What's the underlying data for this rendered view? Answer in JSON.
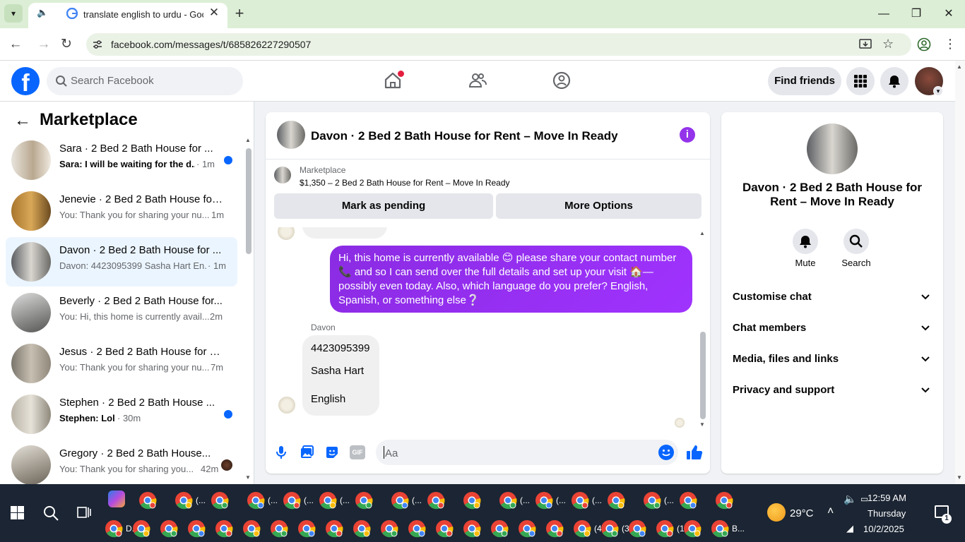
{
  "browser": {
    "tab_title": "translate english to urdu - Goog",
    "url": "facebook.com/messages/t/685826227290507"
  },
  "facebook": {
    "search_placeholder": "Search Facebook",
    "find_friends": "Find friends"
  },
  "marketplace": {
    "title": "Marketplace",
    "conversations": [
      {
        "name": "Sara · 2 Bed 2 Bath House for ...",
        "preview": "Sara: I will be waiting for the d...",
        "time": "· 1m",
        "unread": true,
        "bold_preview": true
      },
      {
        "name": "Jenevie · 2 Bed 2 Bath House for...",
        "preview": "You: Thank you for sharing your nu...",
        "time": "1m",
        "unread": false,
        "bold_preview": false
      },
      {
        "name": "Davon · 2 Bed 2 Bath House for ...",
        "preview": "Davon: 4423095399 Sasha Hart En...",
        "time": "· 1m",
        "unread": false,
        "bold_preview": false
      },
      {
        "name": "Beverly · 2 Bed 2 Bath House for...",
        "preview": "You: Hi, this home is currently avail...",
        "time": "2m",
        "unread": false,
        "bold_preview": false
      },
      {
        "name": "Jesus · 2 Bed 2 Bath House for R...",
        "preview": "You: Thank you for sharing your nu...",
        "time": "7m",
        "unread": false,
        "bold_preview": false
      },
      {
        "name": "Stephen · 2 Bed 2 Bath House ...",
        "preview": "Stephen: Lol",
        "time": "· 30m",
        "unread": true,
        "bold_preview": true
      },
      {
        "name": "Gregory · 2 Bed 2 Bath House...",
        "preview": "You: Thank you for sharing you...",
        "time": "42m",
        "unread": false,
        "bold_preview": false
      }
    ]
  },
  "chat": {
    "title": "Davon · 2 Bed 2 Bath House for Rent – Move In Ready",
    "listing_label": "Marketplace",
    "listing_price": "$1,350 – 2 Bed 2 Bath House for Rent – Move In Ready",
    "mark_pending": "Mark as pending",
    "more_options": "More Options",
    "sent_message": "Hi, this home is currently available 😊 please share your contact number 📞 and  so I can send over the full details and set up your visit 🏠—possibly even today. Also, which language do you prefer? English, Spanish, or something else❔",
    "received_sender": "Davon",
    "received_lines": [
      "4423095399",
      "Sasha Hart",
      "English"
    ],
    "compose_placeholder": "Aa"
  },
  "details": {
    "name": "Davon · 2 Bed 2 Bath House for Rent – Move In Ready",
    "mute": "Mute",
    "search": "Search",
    "sections": [
      "Customise chat",
      "Chat members",
      "Media, files and links",
      "Privacy and support"
    ]
  },
  "taskbar": {
    "temperature": "29°C",
    "time": "12:59 AM",
    "day": "Thursday",
    "date": "10/2/2025",
    "window_labels_row1": [
      "(...",
      "(...",
      "(...",
      "(...",
      "(...",
      "(...",
      "(...",
      "(...",
      "(..."
    ],
    "window_labels_row2": [
      "D...",
      "(4...",
      "(3...",
      "(1...",
      "B..."
    ]
  },
  "colors": {
    "brand": "#0866ff",
    "sent_bubble": "#9333ea",
    "unread_dot": "#0866ff"
  }
}
